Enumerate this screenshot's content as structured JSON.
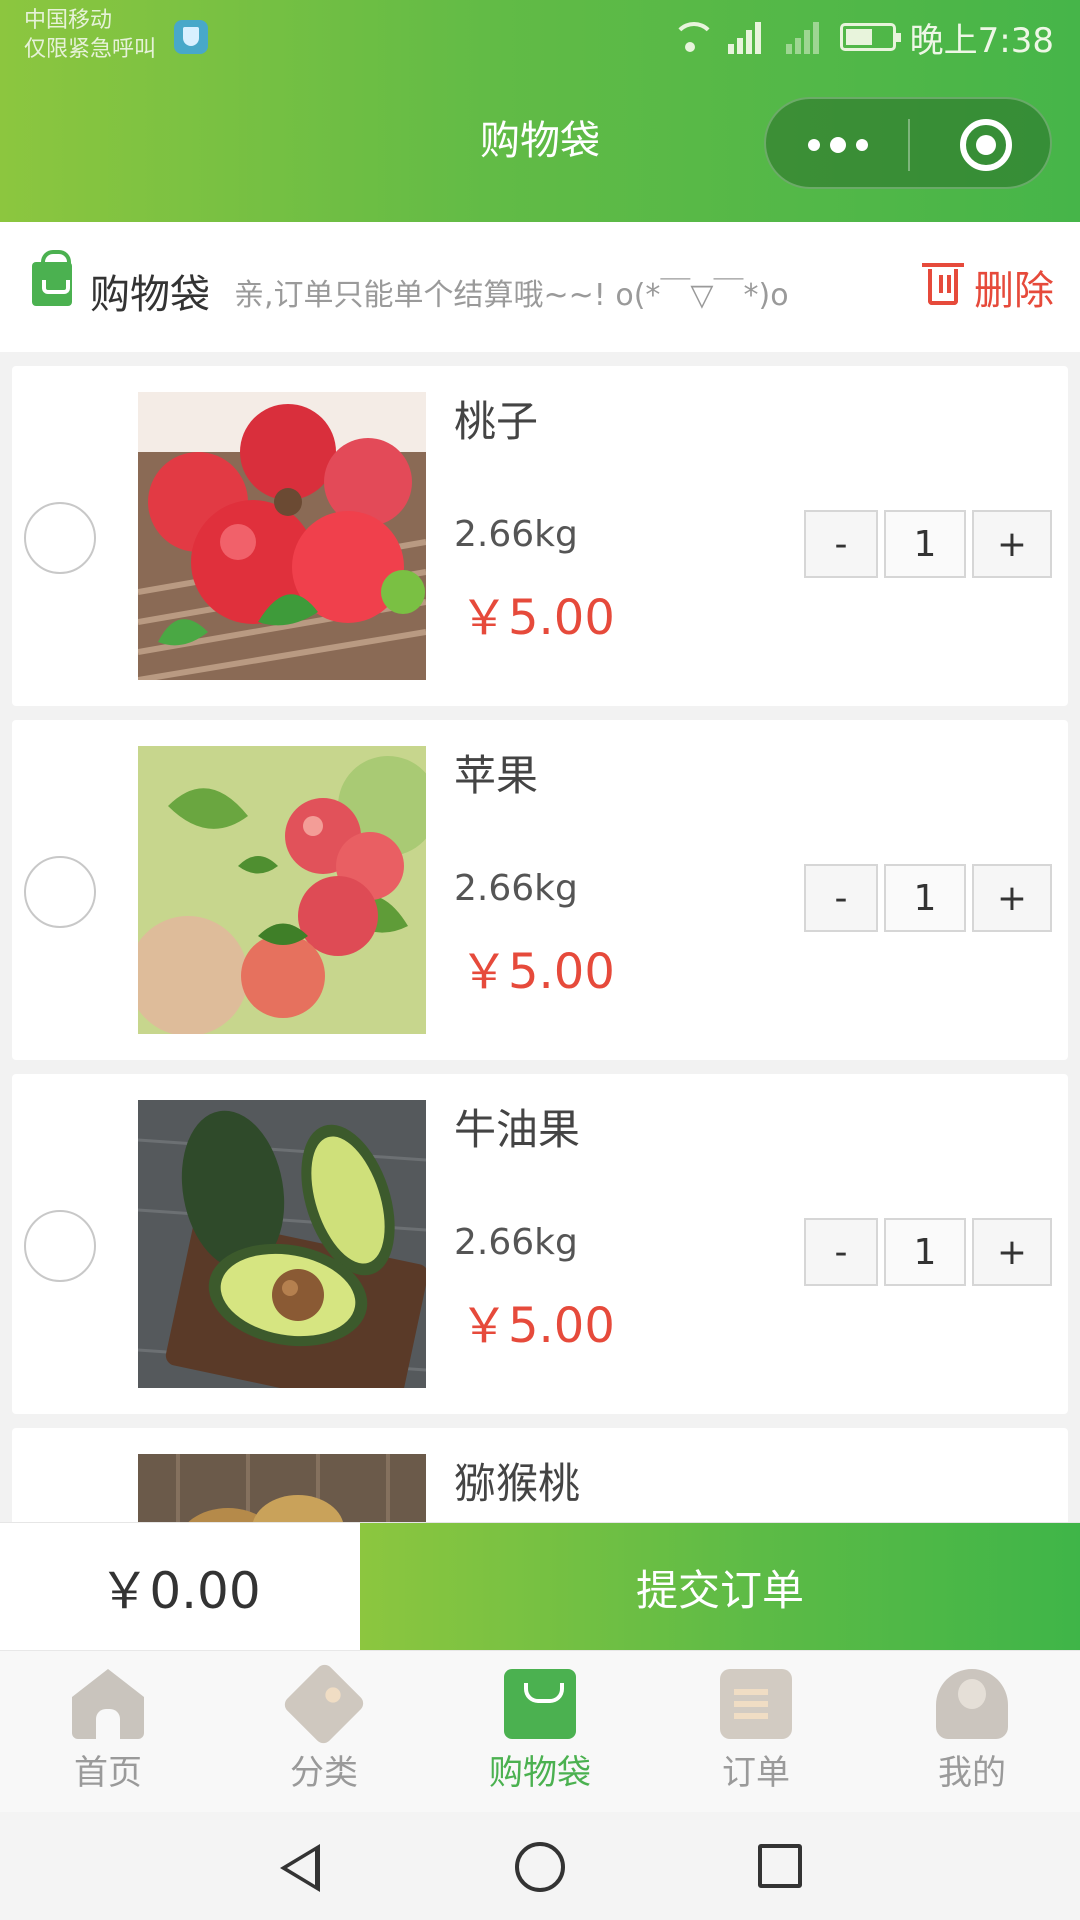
{
  "status_bar": {
    "carrier_line1": "中国移动",
    "carrier_line2": "仅限紧急呼叫",
    "time": "晚上7:38"
  },
  "nav": {
    "title": "购物袋"
  },
  "section": {
    "title": "购物袋",
    "tip": "亲,订单只能单个结算哦~~!  o(*￣▽￣*)o",
    "delete_label": "删除"
  },
  "cart": {
    "items": [
      {
        "name": "桃子",
        "weight": "2.66kg",
        "price": "￥5.00",
        "qty": "1",
        "minus": "-",
        "plus": "+"
      },
      {
        "name": "苹果",
        "weight": "2.66kg",
        "price": "￥5.00",
        "qty": "1",
        "minus": "-",
        "plus": "+"
      },
      {
        "name": "牛油果",
        "weight": "2.66kg",
        "price": "￥5.00",
        "qty": "1",
        "minus": "-",
        "plus": "+"
      },
      {
        "name": "猕猴桃"
      }
    ]
  },
  "footer": {
    "total": "￥0.00",
    "submit_label": "提交订单"
  },
  "tabbar": {
    "items": [
      {
        "label": "首页",
        "icon": "home-icon"
      },
      {
        "label": "分类",
        "icon": "tag-icon"
      },
      {
        "label": "购物袋",
        "icon": "shopping-bag-icon"
      },
      {
        "label": "订单",
        "icon": "order-icon"
      },
      {
        "label": "我的",
        "icon": "profile-icon"
      }
    ]
  },
  "colors": {
    "brand_green": "#4bb150",
    "price_red": "#e64a3b"
  }
}
